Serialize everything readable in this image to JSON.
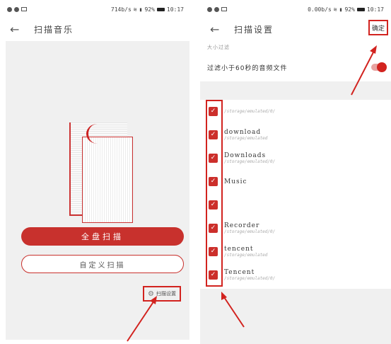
{
  "left_screen": {
    "status_bar": {
      "network_speed": "714b/s",
      "battery_percent": "92%",
      "time": "10:17"
    },
    "title": "扫描音乐",
    "back_icon": "back-arrow-icon",
    "full_scan_label": "全盘扫描",
    "custom_scan_label": "自定义扫描",
    "scan_settings_label": "扫描设置",
    "scan_settings_icon": "gear-icon"
  },
  "right_screen": {
    "status_bar": {
      "network_speed": "0.00b/s",
      "battery_percent": "92%",
      "time": "10:17"
    },
    "title": "扫描设置",
    "confirm_label": "确定",
    "section_header": "大小过滤",
    "filter_label": "过滤小于60秒的音频文件",
    "filter_enabled": true,
    "folders": [
      {
        "name": "",
        "path": "/storage/emulated/0/",
        "checked": true
      },
      {
        "name": "download",
        "path": "/storage/emulated",
        "checked": true
      },
      {
        "name": "Downloads",
        "path": "/storage/emulated/0/",
        "checked": true
      },
      {
        "name": "Music",
        "path": "",
        "checked": true
      },
      {
        "name": "",
        "path": "",
        "checked": true
      },
      {
        "name": "Recorder",
        "path": "/storage/emulated/0/",
        "checked": true
      },
      {
        "name": "tencent",
        "path": "/storage/emulated",
        "checked": true
      },
      {
        "name": "Tencent",
        "path": "/storage/emulated/0/",
        "checked": true
      }
    ]
  },
  "colors": {
    "accent": "#c8312d",
    "highlight": "#d2231f",
    "background": "#f0f0f0"
  }
}
